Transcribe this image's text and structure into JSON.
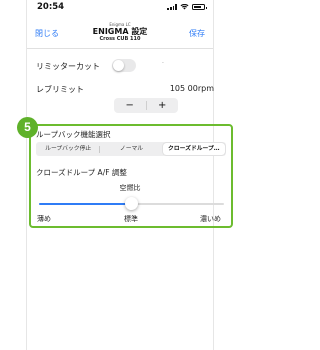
{
  "status_bar": {
    "time": "20:54",
    "battery_level": 0.8
  },
  "nav": {
    "back_label": "閉じる",
    "save_label": "保存",
    "small_label": "Enigma LC",
    "title": "ENIGMA 設定",
    "subtitle": "Cross CUB 110"
  },
  "limiter_cut": {
    "label": "リミッターカット",
    "enabled": false,
    "dot": "-"
  },
  "rev_limit": {
    "label": "レブリミット",
    "value": "105 00rpm",
    "minus": "−",
    "plus": "+"
  },
  "step_badge": "5",
  "loopback": {
    "label": "ループバック機能選択",
    "options": [
      "ループバック停止",
      "ノーマル",
      "クローズドループ…"
    ],
    "selected_index": 2
  },
  "af_adjust": {
    "title": "クローズドループ A/F 調整",
    "center_label": "空燃比",
    "low_label": "薄め",
    "mid_label": "標準",
    "high_label": "濃いめ",
    "slider_value": 0.5
  },
  "colors": {
    "accent": "#2f7cf6",
    "highlight": "#6cbc2f",
    "badge": "#5fb12a"
  }
}
